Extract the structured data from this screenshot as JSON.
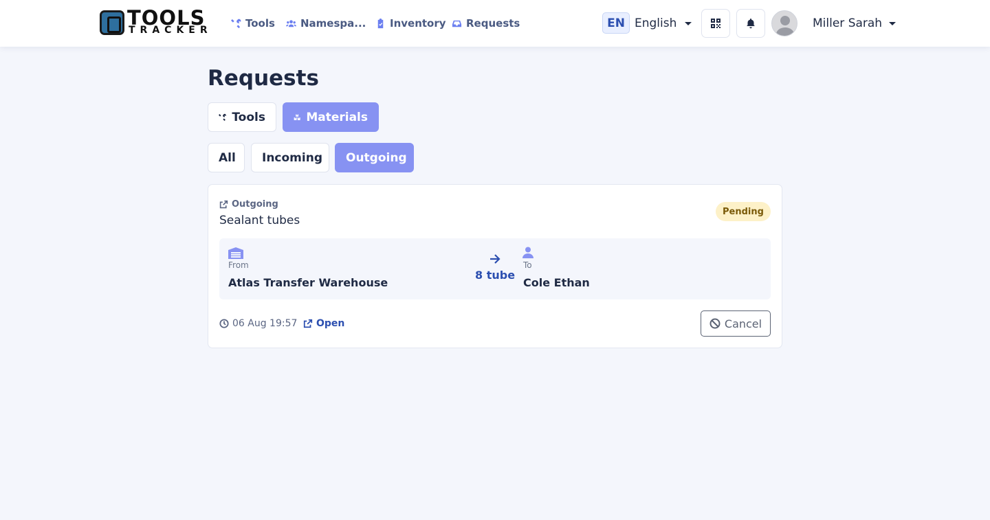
{
  "brand": {
    "line1": "TOOLS",
    "line2": "TRACKER"
  },
  "nav": {
    "tools": "Tools",
    "namespaces": "Namespa...",
    "inventory": "Inventory",
    "requests": "Requests"
  },
  "language": {
    "code": "EN",
    "label": "English"
  },
  "user": {
    "name": "Miller Sarah"
  },
  "page": {
    "title": "Requests"
  },
  "type_tabs": {
    "tools": "Tools",
    "materials": "Materials",
    "active": "materials"
  },
  "direction_tabs": {
    "all": "All",
    "incoming": "Incoming",
    "outgoing": "Outgoing",
    "active": "outgoing"
  },
  "request": {
    "direction": "Outgoing",
    "title": "Sealant tubes",
    "status": "Pending",
    "from_label": "From",
    "from_value": "Atlas Transfer Warehouse",
    "quantity": "8 tube",
    "to_label": "To",
    "to_value": "Cole Ethan",
    "timestamp": "06 Aug 19:57",
    "open_label": "Open",
    "cancel_label": "Cancel"
  },
  "icons": {
    "tools": "wrench-screwdriver-icon",
    "namespaces": "users-icon",
    "inventory": "clipboard-icon",
    "requests": "inbox-icon",
    "qr": "qr-code-icon",
    "notifications": "bell-icon",
    "materials": "boxes-icon",
    "external": "external-link-icon",
    "warehouse": "warehouse-icon",
    "arrow": "arrow-right-icon",
    "person": "user-icon",
    "clock": "clock-icon",
    "cancel": "ban-icon"
  },
  "colors": {
    "accent": "#8792f2",
    "link": "#2c4fb0",
    "pending_bg": "#fdf1c8",
    "pending_text": "#7a5a09"
  }
}
